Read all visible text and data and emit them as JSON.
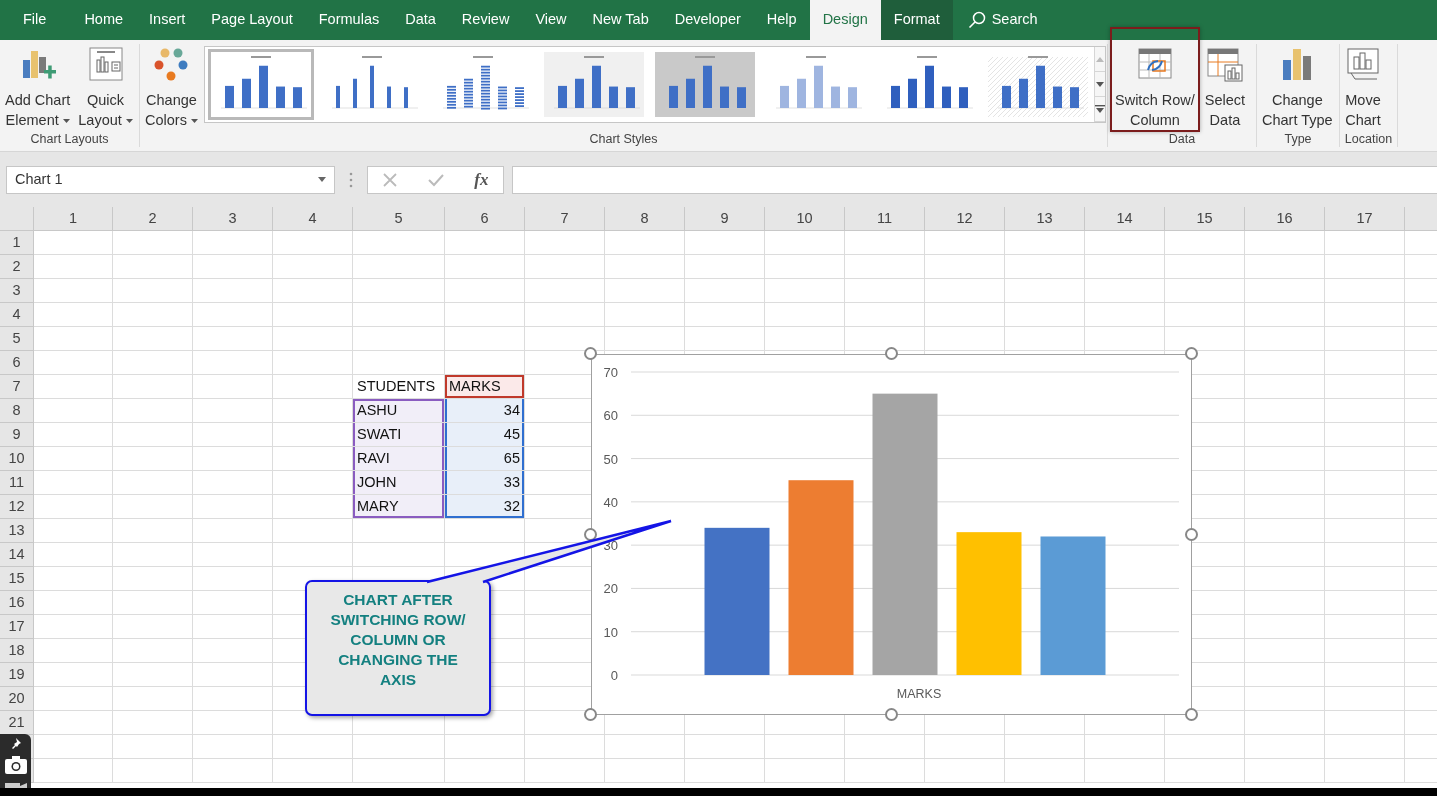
{
  "ribbon_tabs": [
    {
      "label": "File",
      "kind": "tab",
      "selected": false
    },
    {
      "label": "Home",
      "kind": "tab",
      "selected": false
    },
    {
      "label": "Insert",
      "kind": "tab",
      "selected": false
    },
    {
      "label": "Page Layout",
      "kind": "tab",
      "selected": false
    },
    {
      "label": "Formulas",
      "kind": "tab",
      "selected": false
    },
    {
      "label": "Data",
      "kind": "tab",
      "selected": false
    },
    {
      "label": "Review",
      "kind": "tab",
      "selected": false
    },
    {
      "label": "View",
      "kind": "tab",
      "selected": false
    },
    {
      "label": "New Tab",
      "kind": "tab",
      "selected": false
    },
    {
      "label": "Developer",
      "kind": "tab",
      "selected": false
    },
    {
      "label": "Help",
      "kind": "tab",
      "selected": false
    },
    {
      "label": "Design",
      "kind": "contextual",
      "selected": true
    },
    {
      "label": "Format",
      "kind": "contextual",
      "selected": false
    },
    {
      "label": "Search",
      "kind": "search",
      "selected": false
    }
  ],
  "ribbon_groups": [
    {
      "label": "Chart Layouts",
      "commands": [
        {
          "kind": "add_element",
          "lines": [
            "Add Chart",
            "Element"
          ],
          "dropdown": true,
          "highlighted": false
        },
        {
          "kind": "quick_layout",
          "lines": [
            "Quick",
            "Layout"
          ],
          "dropdown": true,
          "highlighted": false
        }
      ]
    },
    {
      "label": "Chart Styles",
      "commands": [
        {
          "kind": "change_colors",
          "lines": [
            "Change",
            "Colors"
          ],
          "dropdown": true,
          "highlighted": false
        }
      ],
      "chart_styles": [
        {
          "kind": "plain",
          "selected": true
        },
        {
          "kind": "thin",
          "selected": false
        },
        {
          "kind": "striped",
          "selected": false
        },
        {
          "kind": "shaded",
          "selected": false
        },
        {
          "kind": "dark",
          "selected": false
        },
        {
          "kind": "light",
          "selected": false
        },
        {
          "kind": "solid",
          "selected": false
        },
        {
          "kind": "hatched",
          "selected": false
        }
      ]
    },
    {
      "label": "Data",
      "commands": [
        {
          "kind": "switch",
          "lines": [
            "Switch Row/",
            "Column"
          ],
          "dropdown": false,
          "highlighted": true
        },
        {
          "kind": "select_data",
          "lines": [
            "Select",
            "Data"
          ],
          "dropdown": false,
          "highlighted": false
        }
      ]
    },
    {
      "label": "Type",
      "commands": [
        {
          "kind": "chart_type",
          "lines": [
            "Change",
            "Chart Type"
          ],
          "dropdown": false,
          "highlighted": false
        }
      ]
    },
    {
      "label": "Location",
      "commands": [
        {
          "kind": "move_chart",
          "lines": [
            "Move",
            "Chart"
          ],
          "dropdown": false,
          "highlighted": false
        }
      ]
    }
  ],
  "formula_bar": {
    "name_box": "Chart 1",
    "function_button": "fx"
  },
  "sheet": {
    "columns": [
      "1",
      "2",
      "3",
      "4",
      "5",
      "6",
      "7",
      "8",
      "9",
      "10",
      "11",
      "12",
      "13",
      "14",
      "15",
      "16",
      "17"
    ],
    "rows": [
      "1",
      "2",
      "3",
      "4",
      "5",
      "6",
      "7",
      "8",
      "9",
      "10",
      "11",
      "12",
      "13",
      "14",
      "15",
      "16",
      "17",
      "18",
      "19",
      "20",
      "21"
    ],
    "table": {
      "columns": [
        "STUDENTS",
        "MARKS"
      ],
      "rows": [
        [
          "ASHU",
          "34"
        ],
        [
          "SWATI",
          "45"
        ],
        [
          "RAVI",
          "65"
        ],
        [
          "JOHN",
          "33"
        ],
        [
          "MARY",
          "32"
        ]
      ]
    }
  },
  "chart": {
    "selected": true,
    "chart_data": {
      "type": "bar",
      "categories": [
        "MARKS"
      ],
      "series": [
        {
          "color": "#4472c4",
          "values": [
            34
          ]
        },
        {
          "color": "#ed7d31",
          "values": [
            45
          ]
        },
        {
          "color": "#a5a5a5",
          "values": [
            65
          ]
        },
        {
          "color": "#ffc000",
          "values": [
            33
          ]
        },
        {
          "color": "#5b9bd5",
          "values": [
            32
          ]
        }
      ],
      "grid": true,
      "ylim": [
        0,
        70
      ],
      "yticks": [
        0,
        10,
        20,
        30,
        40,
        50,
        60,
        70
      ]
    }
  },
  "callout": {
    "text": "CHART AFTER SWITCHING ROW/ COLUMN OR CHANGING THE AXIS"
  }
}
